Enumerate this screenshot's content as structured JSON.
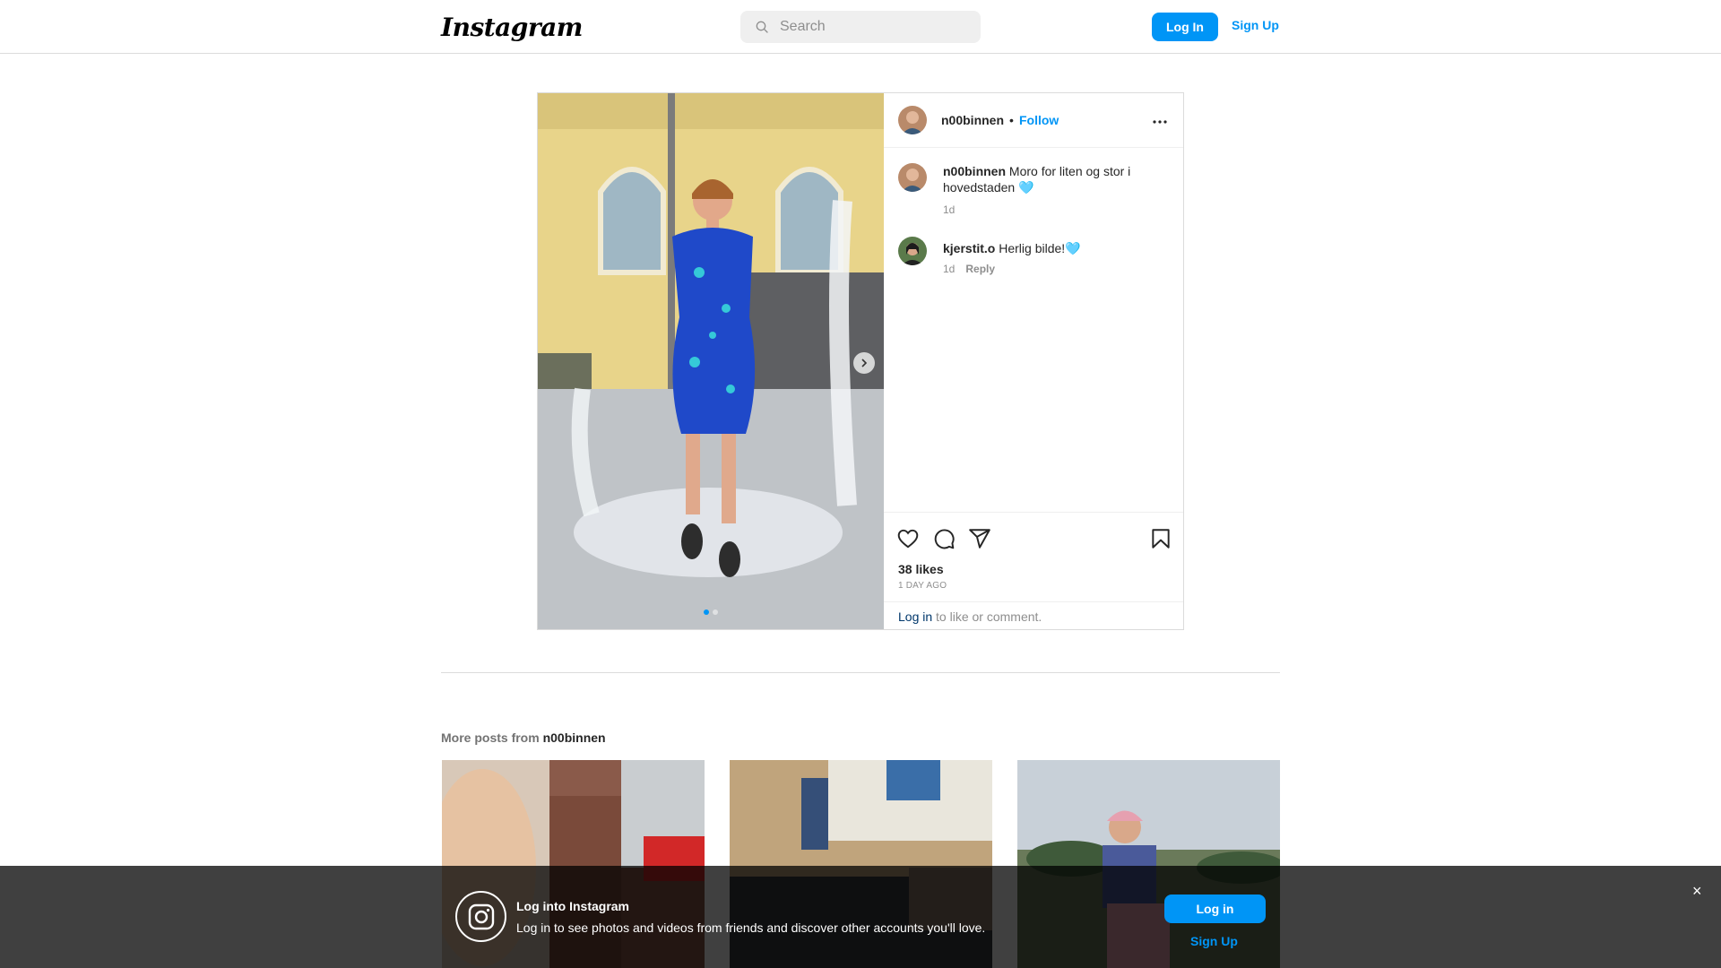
{
  "nav": {
    "logo": "Instagram",
    "search_placeholder": "Search",
    "login_label": "Log In",
    "signup_label": "Sign Up"
  },
  "post": {
    "username": "n00binnen",
    "separator": "•",
    "follow_label": "Follow",
    "caption": {
      "username": "n00binnen",
      "text": "Moro for liten og stor i hovedstaden 🩵",
      "time": "1d"
    },
    "comments": [
      {
        "username": "kjerstit.o",
        "text": "Herlig bilde!🩵",
        "time": "1d",
        "reply_label": "Reply"
      }
    ],
    "likes": "38 likes",
    "time_ago": "1 DAY AGO",
    "login_prompt": {
      "link": "Log in",
      "text": " to like or comment."
    },
    "carousel": {
      "slides": 2,
      "active_index": 0
    }
  },
  "more_posts": {
    "prefix": "More posts from ",
    "username": "n00binnen"
  },
  "banner": {
    "title": "Log into Instagram",
    "subtitle": "Log in to see photos and videos from friends and discover other accounts you'll love.",
    "login_label": "Log in",
    "signup_label": "Sign Up",
    "close_glyph": "×"
  },
  "colors": {
    "accent": "#0095f6",
    "link_dark": "#00376b",
    "text": "#262626",
    "muted": "#8e8e8e",
    "border": "#dbdbdb"
  },
  "icons": [
    "search-icon",
    "more-options-icon",
    "chevron-right-icon",
    "heart-icon",
    "comment-icon",
    "share-icon",
    "bookmark-icon",
    "instagram-icon",
    "close-icon"
  ]
}
